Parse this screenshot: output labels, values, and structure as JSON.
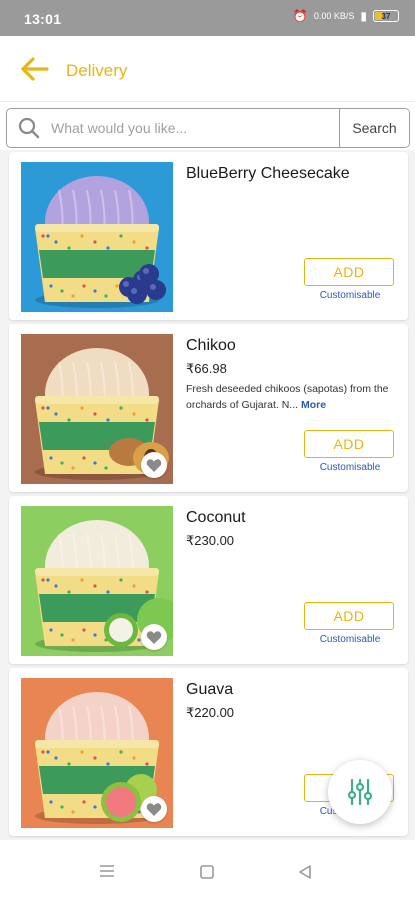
{
  "status_bar": {
    "time": "13:01",
    "indicators": [
      "alarm-icon",
      "network-speed-icon",
      "signal-icon"
    ],
    "network_speed": "0.00 KB/S",
    "battery_level": "37",
    "battery_percent": 37
  },
  "header": {
    "back_icon": "arrow-left-icon",
    "title": "Delivery"
  },
  "search": {
    "placeholder": "What would you like...",
    "value": "",
    "button_label": "Search"
  },
  "products": [
    {
      "name": "BlueBerry Cheesecake",
      "price": "",
      "description": "",
      "more_label": "",
      "add_label": "ADD",
      "customisable_label": "Customisable",
      "image": {
        "bg": "#2d9ad8",
        "scoop": "#b2a2de",
        "fruit": "blueberry"
      },
      "favorite_icon": ""
    },
    {
      "name": "Chikoo",
      "price": "₹66.98",
      "description": "Fresh deseeded chikoos (sapotas) from the orchards of Gujarat. N...",
      "more_label": "More",
      "add_label": "ADD",
      "customisable_label": "Customisable",
      "image": {
        "bg": "#a86c4e",
        "scoop": "#f0dcc0",
        "fruit": "chikoo"
      },
      "favorite_icon": "heart-icon"
    },
    {
      "name": "Coconut",
      "price": "₹230.00",
      "description": "",
      "more_label": "",
      "add_label": "ADD",
      "customisable_label": "Customisable",
      "image": {
        "bg": "#8ccf60",
        "scoop": "#f2ecdc",
        "fruit": "coconut"
      },
      "favorite_icon": "heart-icon"
    },
    {
      "name": "Guava",
      "price": "₹220.00",
      "description": "",
      "more_label": "",
      "add_label": "ADD",
      "customisable_label": "Customisable",
      "image": {
        "bg": "#e88552",
        "scoop": "#f5d2c8",
        "fruit": "guava"
      },
      "favorite_icon": "heart-icon"
    }
  ],
  "filter_fab": {
    "icon": "filter-sliders-icon"
  },
  "nav_bar": {
    "items": [
      "menu-icon",
      "home-icon",
      "back-triangle-icon"
    ]
  },
  "colors": {
    "accent": "#e7b614",
    "link": "#2a5ab8",
    "status_bar": "#9a9a9a",
    "list_bg": "#f3f3f3"
  }
}
